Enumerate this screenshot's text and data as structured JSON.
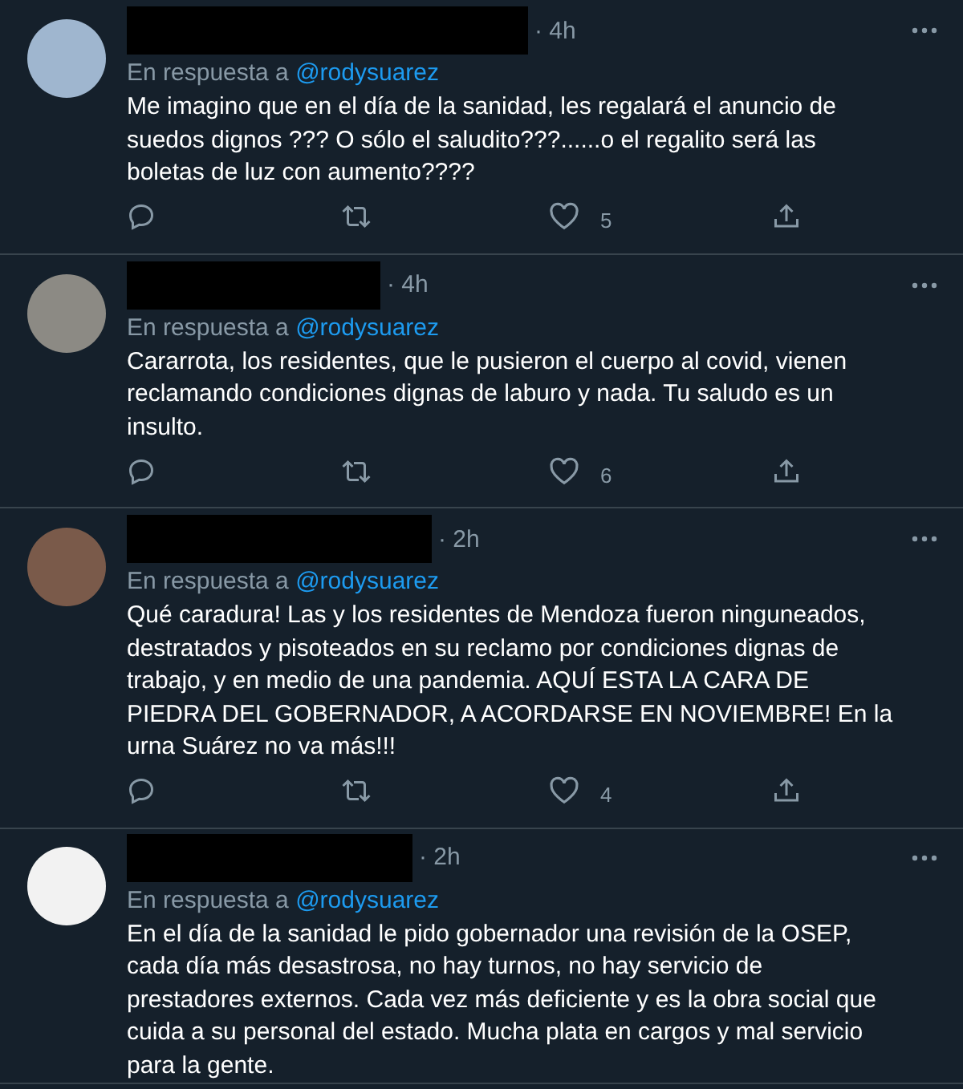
{
  "tweets": [
    {
      "time": "· 4h",
      "reply_prefix": "En respuesta a",
      "reply_to": "@rodysuarez",
      "text": "Me imagino que en el día de la sanidad, les regalará el anuncio de suedos dignos ??? O sólo el saludito???......o el regalito será las boletas de luz con aumento????",
      "likes": "5"
    },
    {
      "time": "· 4h",
      "reply_prefix": "En respuesta a",
      "reply_to": "@rodysuarez",
      "text": "Cararrota, los residentes, que le pusieron el cuerpo al covid, vienen reclamando condiciones dignas de laburo y nada. Tu saludo es un insulto.",
      "likes": "6"
    },
    {
      "time": "· 2h",
      "reply_prefix": "En respuesta a",
      "reply_to": "@rodysuarez",
      "text": "Qué caradura! Las y los residentes de Mendoza fueron ninguneados, destratados y pisoteados en su reclamo por condiciones dignas de trabajo, y en medio de una pandemia. AQUÍ ESTA LA CARA DE PIEDRA DEL GOBERNADOR, A ACORDARSE EN NOVIEMBRE! En la urna Suárez no va más!!!",
      "likes": "4"
    },
    {
      "time": "· 2h",
      "reply_prefix": "En respuesta a",
      "reply_to": "@rodysuarez",
      "text": "En el día de la sanidad le pido gobernador una revisión de la OSEP, cada día más desastrosa, no hay turnos, no hay servicio de prestadores externos. Cada vez más deficiente y es la obra social que cuida a su personal del estado. Mucha plata en cargos y mal servicio para la gente."
    }
  ]
}
